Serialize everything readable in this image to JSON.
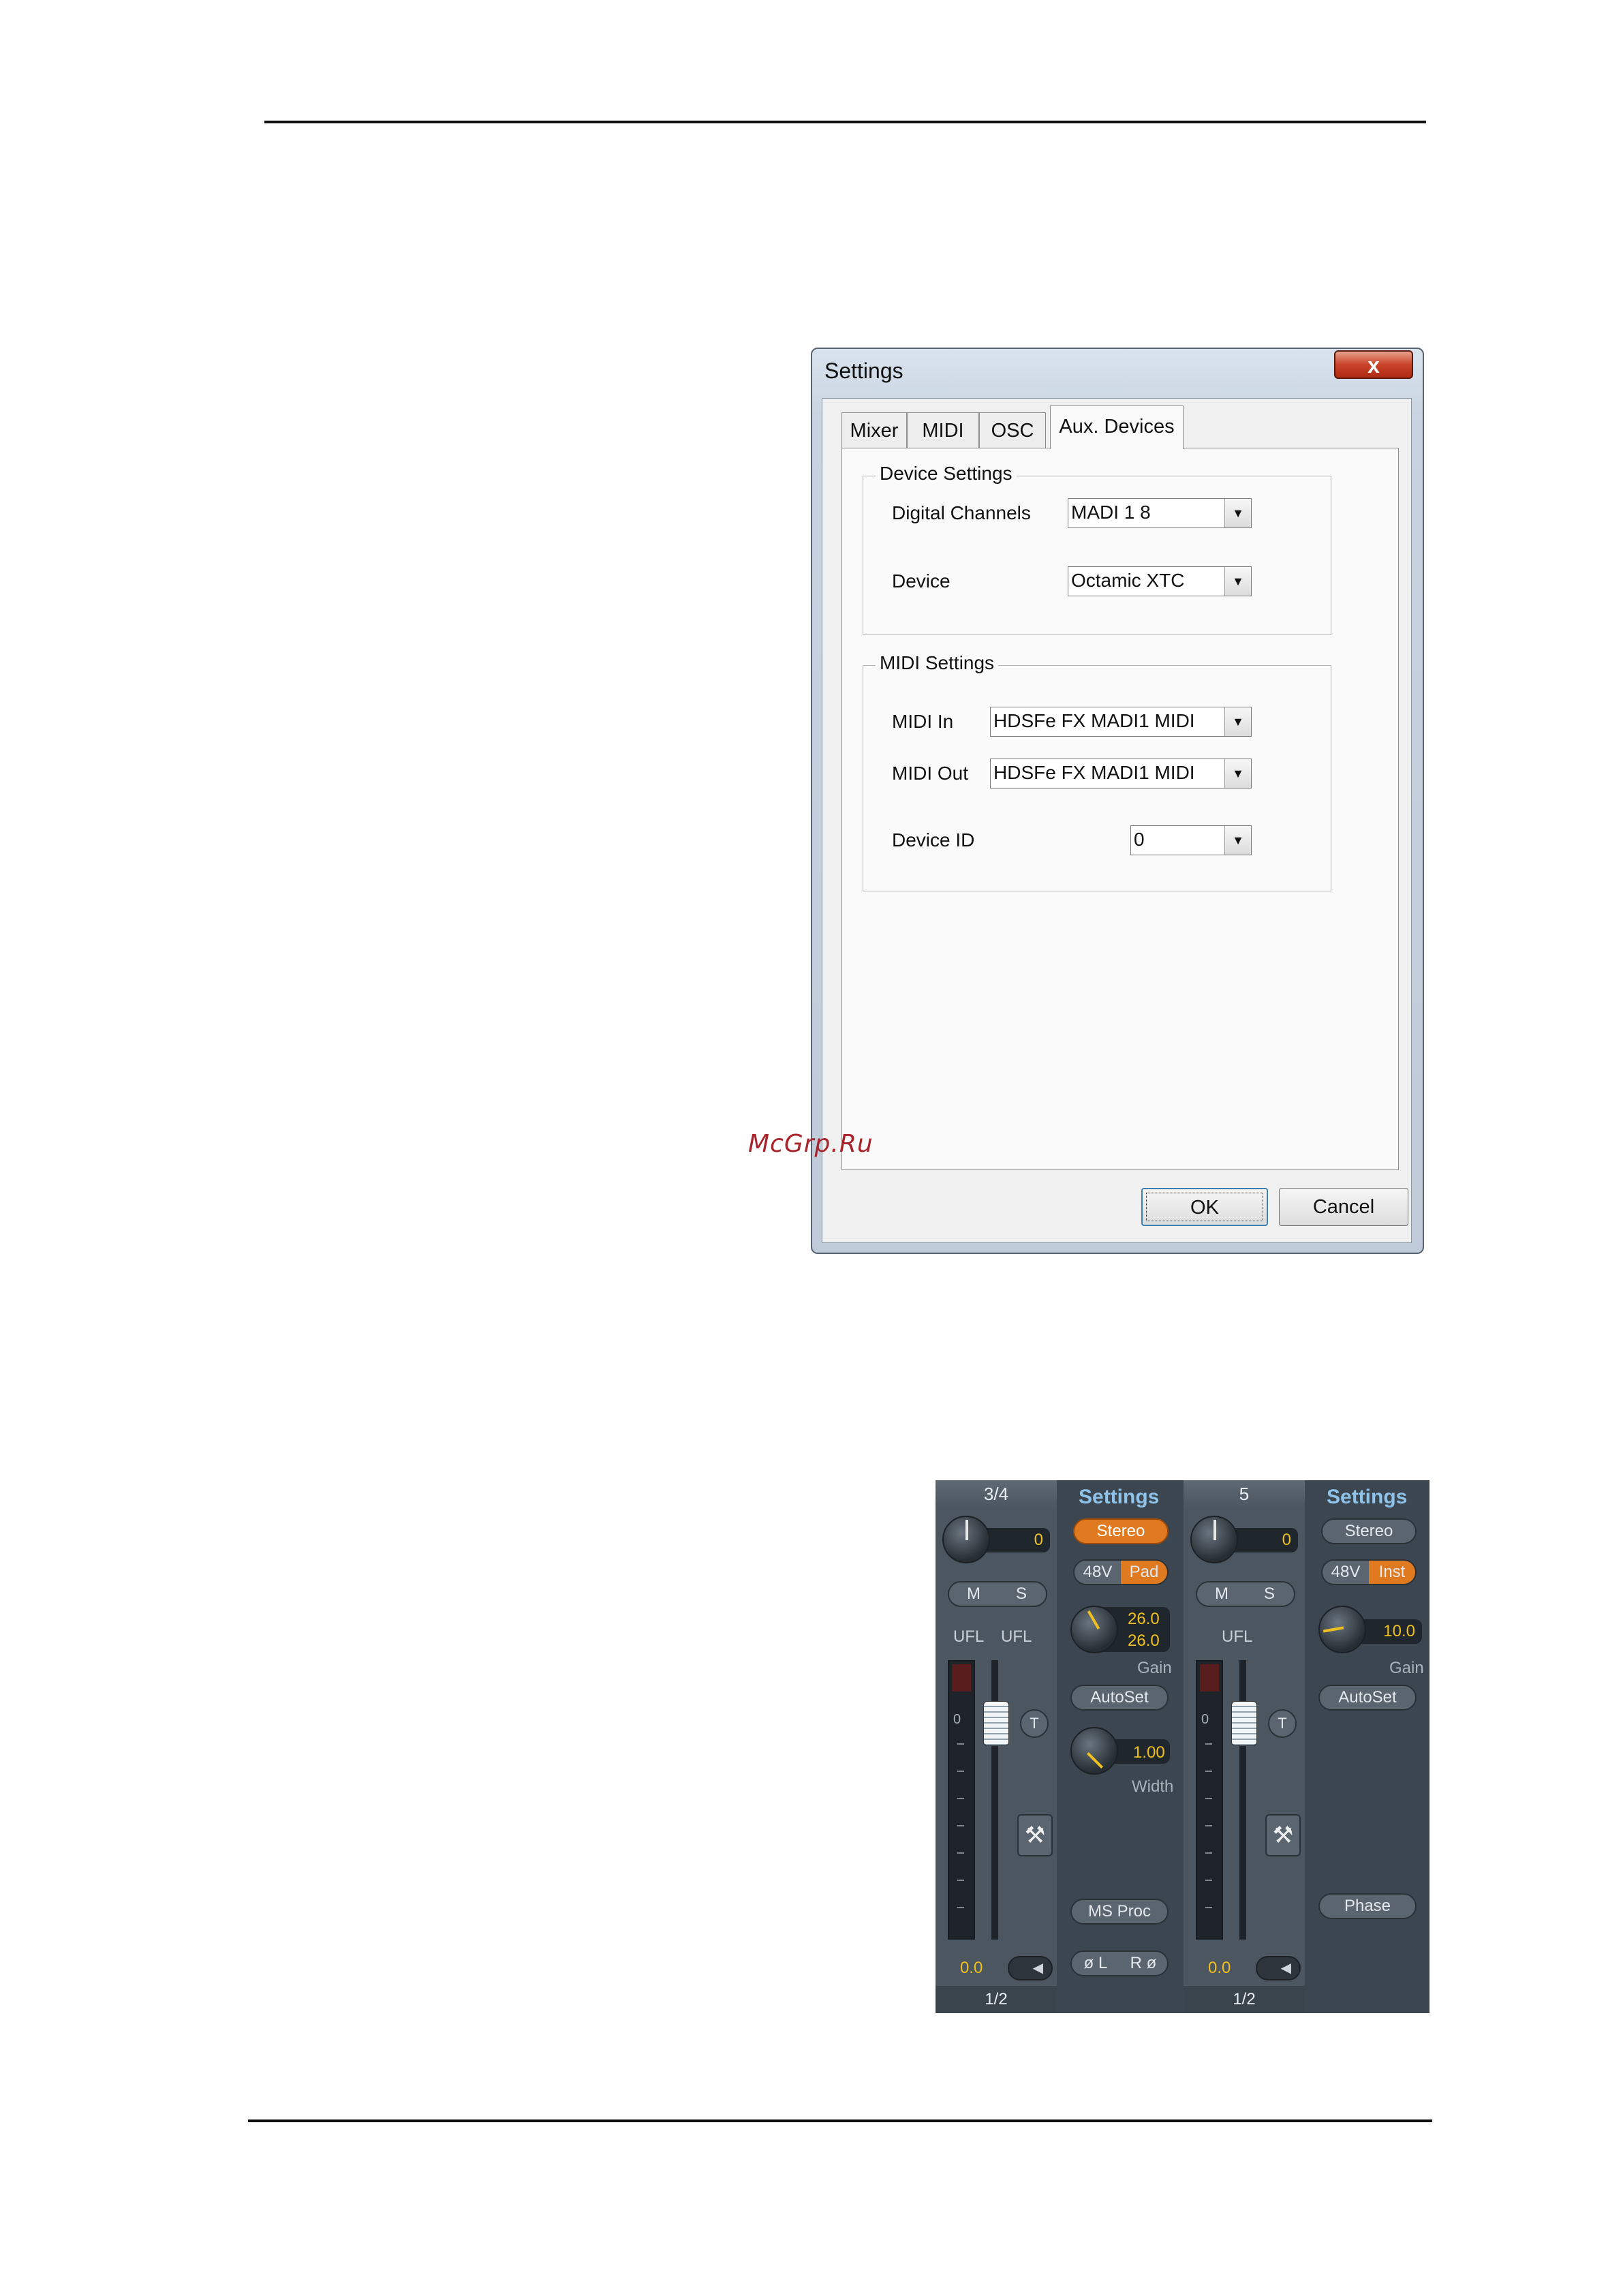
{
  "dialog": {
    "title": "Settings",
    "close_glyph": "x",
    "tabs": [
      {
        "label": "Mixer",
        "active": false
      },
      {
        "label": "MIDI",
        "active": false
      },
      {
        "label": "OSC",
        "active": false
      },
      {
        "label": "Aux. Devices",
        "active": true
      }
    ],
    "device_settings": {
      "legend": "Device Settings",
      "digital_channels_label": "Digital Channels",
      "digital_channels_value": "MADI 1 8",
      "device_label": "Device",
      "device_value": "Octamic XTC"
    },
    "midi_settings": {
      "legend": "MIDI Settings",
      "midi_in_label": "MIDI In",
      "midi_in_value": "HDSFe FX MADI1 MIDI",
      "midi_out_label": "MIDI Out",
      "midi_out_value": "HDSFe FX MADI1 MIDI",
      "device_id_label": "Device ID",
      "device_id_value": "0"
    },
    "ok_label": "OK",
    "cancel_label": "Cancel"
  },
  "watermark": "McGrp.Ru",
  "mixer": {
    "strip1": {
      "name": "3/4",
      "pan_value": "0",
      "mute": "M",
      "solo": "S",
      "ufl_left": "UFL",
      "ufl_right": "UFL",
      "t_label": "T",
      "level_value": "0.0",
      "meter_zero": "0",
      "footer": "1/2"
    },
    "settings1": {
      "title": "Settings",
      "stereo": "Stereo",
      "phantom": "48V",
      "pad": "Pad",
      "gain_value_1": "26.0",
      "gain_value_2": "26.0",
      "gain_label": "Gain",
      "autoset": "AutoSet",
      "width_value": "1.00",
      "width_label": "Width",
      "ms_proc": "MS Proc",
      "phase_left": "ø L",
      "phase_right": "R ø"
    },
    "strip2": {
      "name": "5",
      "pan_value": "0",
      "mute": "M",
      "solo": "S",
      "ufl": "UFL",
      "t_label": "T",
      "level_value": "0.0",
      "meter_zero": "0",
      "footer": "1/2"
    },
    "settings2": {
      "title": "Settings",
      "stereo": "Stereo",
      "phantom": "48V",
      "inst": "Inst",
      "gain_value": "10.0",
      "gain_label": "Gain",
      "autoset": "AutoSet",
      "phase": "Phase"
    }
  }
}
